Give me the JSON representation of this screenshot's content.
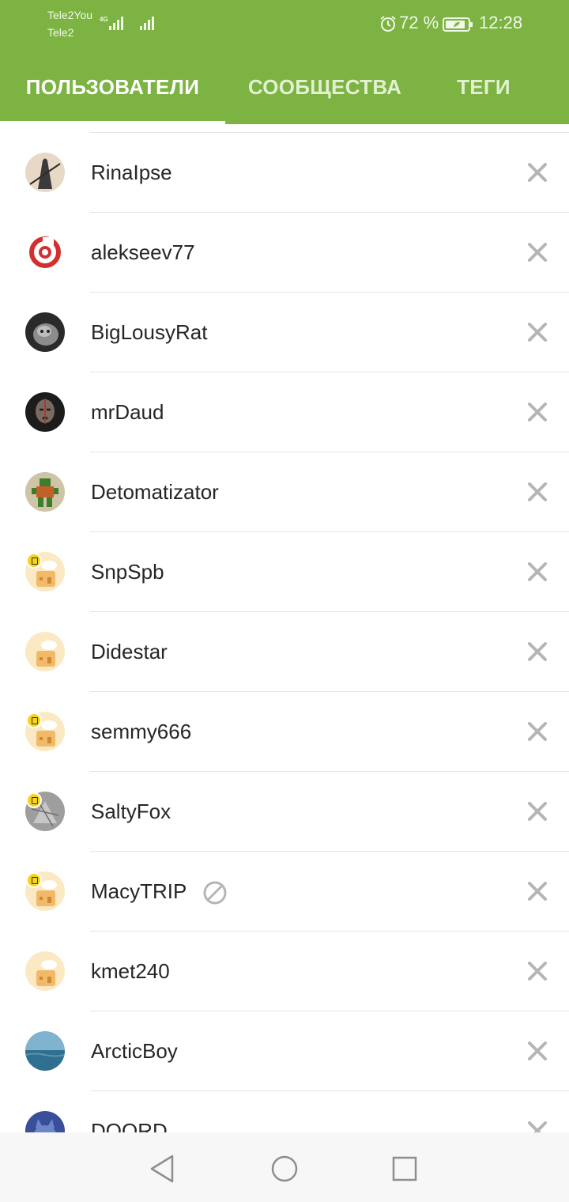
{
  "status_bar": {
    "carrier_1": "Tele2You",
    "carrier_2": "Tele2",
    "network_type": "4G",
    "battery_percent": "72 %",
    "time": "12:28"
  },
  "tabs": [
    {
      "label": "ПОЛЬЗОВАТЕЛИ",
      "active": true
    },
    {
      "label": "СООБЩЕСТВА",
      "active": false
    },
    {
      "label": "ТЕГИ",
      "active": false
    }
  ],
  "users": [
    {
      "name": "RinaIpse",
      "avatar": "photo-dark-figure",
      "badge": false,
      "banned": false
    },
    {
      "name": "alekseev77",
      "avatar": "red-brembo-logo",
      "badge": false,
      "banned": false
    },
    {
      "name": "BigLousyRat",
      "avatar": "photo-cat-grey",
      "badge": false,
      "banned": false
    },
    {
      "name": "mrDaud",
      "avatar": "photo-warrior-face",
      "badge": false,
      "banned": false
    },
    {
      "name": "Detomatizator",
      "avatar": "pixel-art-character",
      "badge": false,
      "banned": false
    },
    {
      "name": "SnpSpb",
      "avatar": "default-house",
      "badge": true,
      "banned": false
    },
    {
      "name": "Didestar",
      "avatar": "default-house",
      "badge": false,
      "banned": false
    },
    {
      "name": "semmy666",
      "avatar": "default-house",
      "badge": true,
      "banned": false
    },
    {
      "name": "SaltyFox",
      "avatar": "photo-grey-sketch",
      "badge": true,
      "banned": false
    },
    {
      "name": "MacyTRIP",
      "avatar": "default-house",
      "badge": true,
      "banned": true
    },
    {
      "name": "kmet240",
      "avatar": "default-house",
      "badge": false,
      "banned": false
    },
    {
      "name": "ArcticBoy",
      "avatar": "photo-sea",
      "badge": false,
      "banned": false
    },
    {
      "name": "DOORD",
      "avatar": "photo-blue-cat",
      "badge": false,
      "banned": false
    }
  ],
  "icons": {
    "remove": "close-x-icon",
    "ban": "ban-circle-icon",
    "badge": "document-badge-icon",
    "nav": [
      "back-triangle-icon",
      "home-circle-icon",
      "recents-square-icon"
    ]
  },
  "colors": {
    "accent": "#7cb342",
    "tab_active": "#ffffff",
    "tab_inactive": "#e3f0d2",
    "text": "#262626",
    "icon_grey": "#b5b5b5",
    "badge_yellow": "#f4d21d"
  }
}
